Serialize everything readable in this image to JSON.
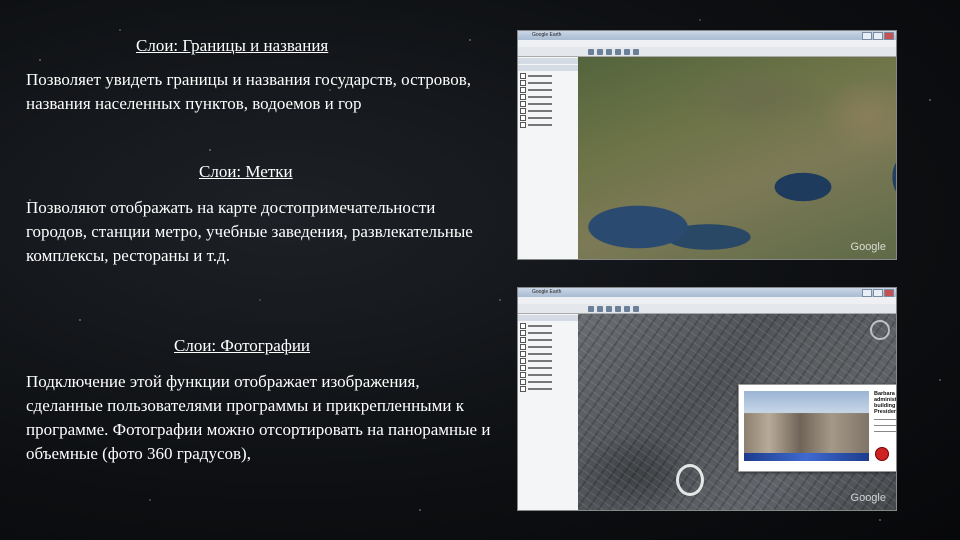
{
  "section1": {
    "heading": "Слои: Границы и названия",
    "text": "Позволяет увидеть границы и названия государств, островов, названия населенных пунктов, водоемов и гор"
  },
  "section2": {
    "heading": "Слои: Метки",
    "text": "Позволяют отображать на карте достопримечательности городов, станции метро, учебные заведения, развлекательные комплексы, рестораны и т.д."
  },
  "section3": {
    "heading": "Слои: Фотографии",
    "text": "Подключение этой функции отображает изображения, сделанные пользователями программы и прикрепленными к программе. Фотографии можно отсортировать на панорамные и объемные (фото 360 градусов),"
  },
  "screenshot1": {
    "window_title": "Google Earth",
    "watermark": "Google"
  },
  "screenshot2": {
    "window_title": "Google Earth",
    "watermark": "Google",
    "popup": {
      "title": "Barbara Sheet - the administrative building of the President",
      "close": "x"
    }
  },
  "colors": {
    "background": "#0d0f12",
    "text": "#ffffff"
  }
}
